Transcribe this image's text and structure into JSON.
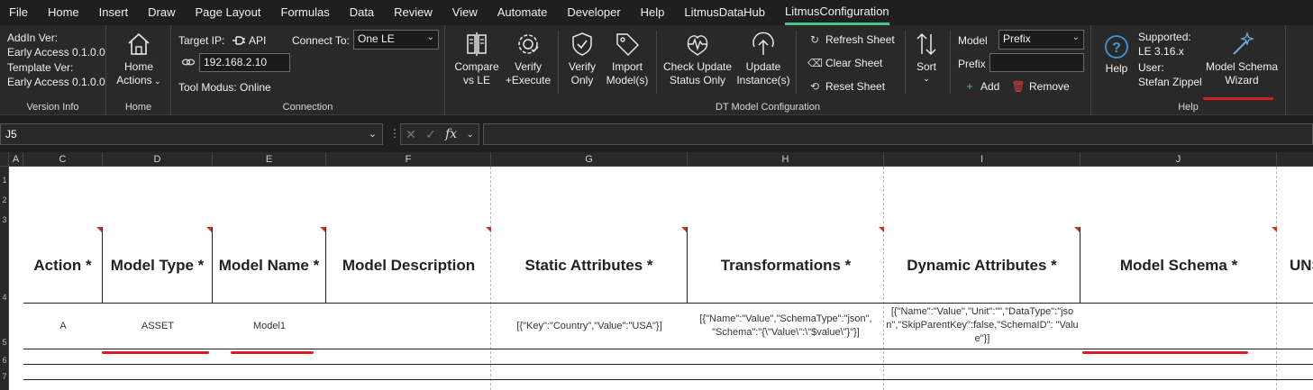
{
  "tabs": [
    "File",
    "Home",
    "Insert",
    "Draw",
    "Page Layout",
    "Formulas",
    "Data",
    "Review",
    "View",
    "Automate",
    "Developer",
    "Help",
    "LitmusDataHub",
    "LitmusConfiguration"
  ],
  "version_info": {
    "addin_label": "AddIn Ver:",
    "addin_value": "Early Access 0.1.0.0",
    "template_label": "Template Ver:",
    "template_value": "Early Access 0.1.0.0",
    "group": "Version Info"
  },
  "home_group": {
    "button_line1": "Home",
    "button_line2": "Actions",
    "group": "Home"
  },
  "connection": {
    "target_ip_label": "Target IP:",
    "api_label": "API",
    "connect_to_label": "Connect To:",
    "connect_to_value": "One LE",
    "ip_value": "192.168.2.10",
    "tool_mode": "Tool Modus: Online",
    "group": "Connection"
  },
  "dt_model": {
    "compare_1": "Compare",
    "compare_2": "vs LE",
    "verify_exec_1": "Verify",
    "verify_exec_2": "+Execute",
    "verify_only_1": "Verify",
    "verify_only_2": "Only",
    "import_1": "Import",
    "import_2": "Model(s)",
    "check_update_1": "Check Update",
    "check_update_2": "Status Only",
    "update_inst_1": "Update",
    "update_inst_2": "Instance(s)",
    "refresh_sheet": "Refresh Sheet",
    "clear_sheet": "Clear Sheet",
    "reset_sheet": "Reset Sheet",
    "sort": "Sort",
    "model_label": "Model",
    "model_value": "Prefix",
    "prefix_label": "Prefix",
    "prefix_value": "",
    "add": "Add",
    "remove": "Remove",
    "group": "DT Model Configuration"
  },
  "help_group": {
    "help": "Help",
    "supported_label": "Supported:",
    "supported_value": "LE 3.16.x",
    "user_label": "User:",
    "user_value": "Stefan Zippel",
    "wizard_1": "Model Schema",
    "wizard_2": "Wizard",
    "group": "Help"
  },
  "formula_bar": {
    "name_box": "J5",
    "fx": "fx",
    "formula": ""
  },
  "columns": [
    "A",
    "C",
    "D",
    "E",
    "F",
    "G",
    "H",
    "I",
    "J"
  ],
  "row_numbers": [
    "1",
    "2",
    "3",
    "4",
    "5",
    "6",
    "7"
  ],
  "header_row": {
    "action": "Action *",
    "model_type": "Model Type *",
    "model_name": "Model Name *",
    "model_description": "Model Description",
    "static_attributes": "Static Attributes *",
    "transformations": "Transformations *",
    "dynamic_attributes": "Dynamic Attributes *",
    "model_schema": "Model Schema *",
    "partial": "UNS"
  },
  "data_row": {
    "action": "A",
    "model_type": "ASSET",
    "model_name": "Model1",
    "model_description": "",
    "static_attributes": "[{\"Key\":\"Country\",\"Value\":\"USA\"}]",
    "transformations": "[{\"Name\":\"Value\",\"SchemaType\":\"json\", \"Schema\":\"{\\\"Value\\\":\\\"$value\\\"}\"}]",
    "dynamic_attributes": "[{\"Name\":\"Value\",\"Unit\":\"\",\"DataType\":\"json\",\"SkipParentKey\":false,\"SchemaID\": \"Value\"}]",
    "model_schema": ""
  },
  "colors": {
    "accent_tab": "#4cc28b",
    "annotation_red": "#d42020",
    "help_icon": "#3a9ad9",
    "wizard_icon": "#6fa8dc",
    "remove_icon": "#e04040",
    "add_icon": "#4cc28b"
  }
}
